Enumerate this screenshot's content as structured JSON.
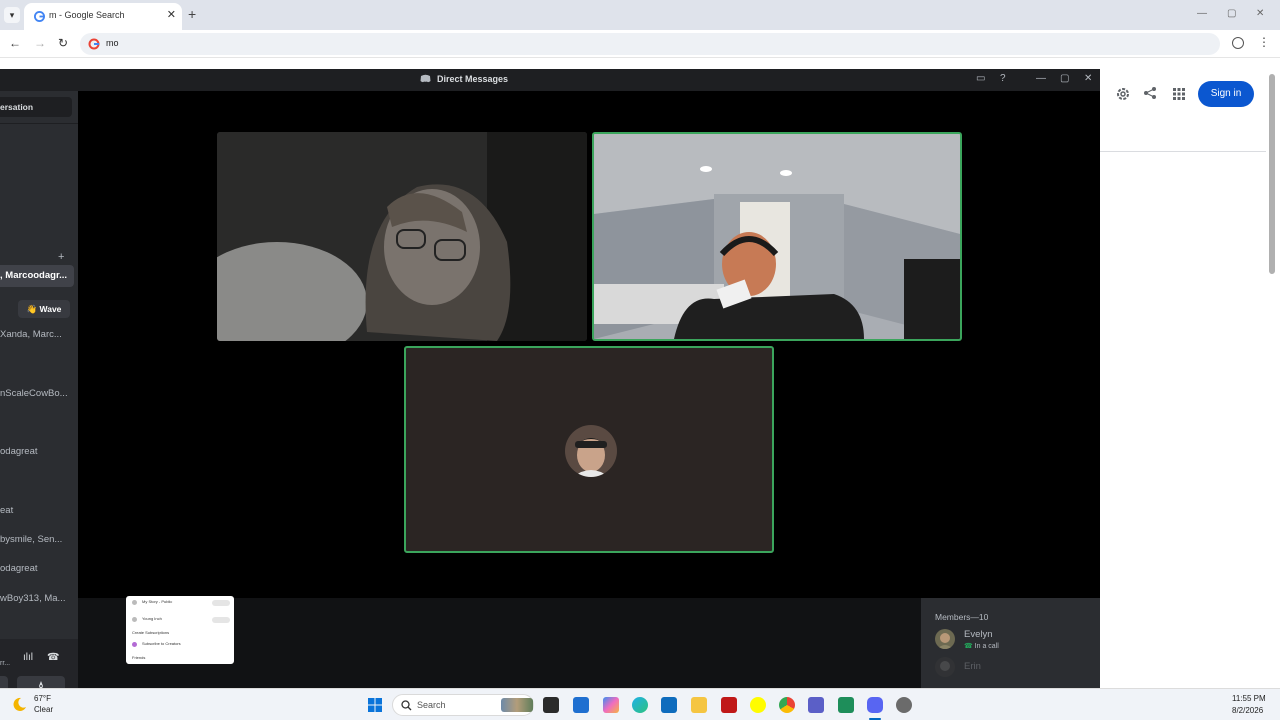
{
  "browser": {
    "tab_title": "m - Google Search",
    "tab_close": "✕",
    "new_tab": "+",
    "omnibox_text": "mo",
    "window_controls": [
      "—",
      "▢",
      "✕"
    ]
  },
  "google": {
    "signin_label": "Sign in",
    "brand_color": "#0b57d0"
  },
  "discord": {
    "window_title": "Direct Messages",
    "window_controls": [
      "—",
      "▢",
      "✕"
    ],
    "sidebar": {
      "search_label": "ersation",
      "add": "+",
      "dm_items": [
        ", Marcoodagr...",
        "Xanda, Marc...",
        "nScaleCowBo...",
        "odagreat",
        "eat",
        "bysmile, Sen...",
        "odagreat",
        "wBoy313, Ma..."
      ],
      "wave_label": "👋 Wave",
      "voice_status": "rr..."
    },
    "members": {
      "header": "Members—10",
      "list": [
        {
          "name": "Evelyn",
          "status": "In a call"
        },
        {
          "name": "Erin",
          "status": ""
        }
      ]
    },
    "thumbnail": {
      "rows": [
        "My Story - Public",
        "Young Inch",
        "Create Subscriptions",
        "Subscribe to Creators",
        "Friends"
      ]
    },
    "accent_speaking": "#3ba55c"
  },
  "taskbar": {
    "weather_temp": "67°F",
    "weather_cond": "Clear",
    "search_label": "Search",
    "time": "11:55 PM",
    "date": "8/2/2026",
    "apps": [
      "task-view",
      "microsoft-store",
      "copilot",
      "edge",
      "outlook",
      "file-explorer",
      "mcafee",
      "snapchat",
      "chrome",
      "teams",
      "phone-link",
      "discord",
      "settings"
    ]
  }
}
